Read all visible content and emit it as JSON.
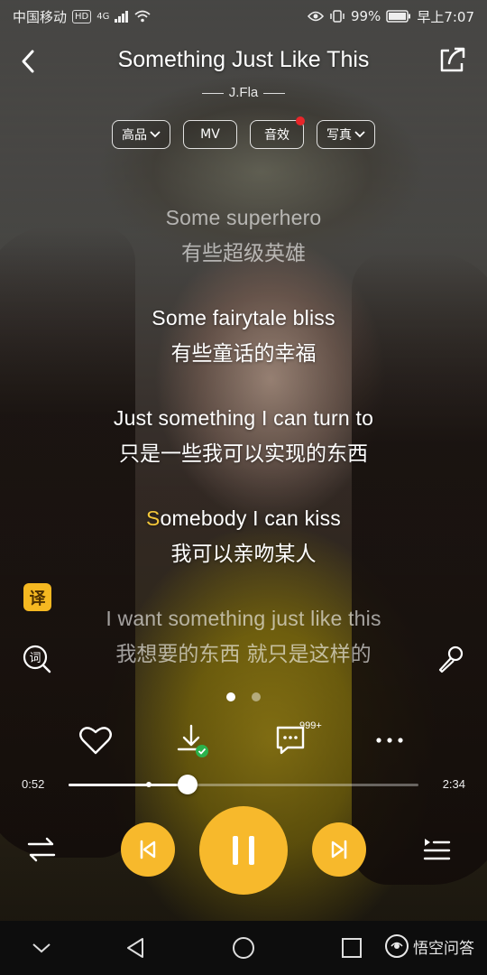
{
  "status_bar": {
    "carrier": "中国移动",
    "hd_badge": "HD",
    "network": "4G",
    "battery": "99%",
    "time": "早上7:07"
  },
  "header": {
    "title": "Something Just Like This",
    "artist": "J.Fla"
  },
  "options": {
    "quality_label": "高品",
    "mv_label": "MV",
    "effects_label": "音效",
    "photo_label": "写真"
  },
  "lyrics": [
    {
      "en": "Some superhero",
      "zh": "有些超级英雄"
    },
    {
      "en": "Some fairytale bliss",
      "zh": "有些童话的幸福"
    },
    {
      "en": "Just something I can turn to",
      "zh": "只是一些我可以实现的东西"
    },
    {
      "en_highlight": "S",
      "en_rest": "omebody I can kiss",
      "zh": "我可以亲吻某人"
    },
    {
      "en": "I want something just like this",
      "zh": "我想要的东西 就只是这样的"
    }
  ],
  "side": {
    "translate_label": "译"
  },
  "actions": {
    "comment_count": "999+"
  },
  "progress": {
    "current_time": "0:52",
    "total_time": "2:34",
    "played_fraction": 0.34,
    "buffered_fraction": 0.23
  },
  "nav": {
    "watermark_text": "悟空问答"
  },
  "colors": {
    "accent": "#f7b92c",
    "lyric_highlight": "#f5c83a",
    "badge_red": "#e8262a"
  }
}
